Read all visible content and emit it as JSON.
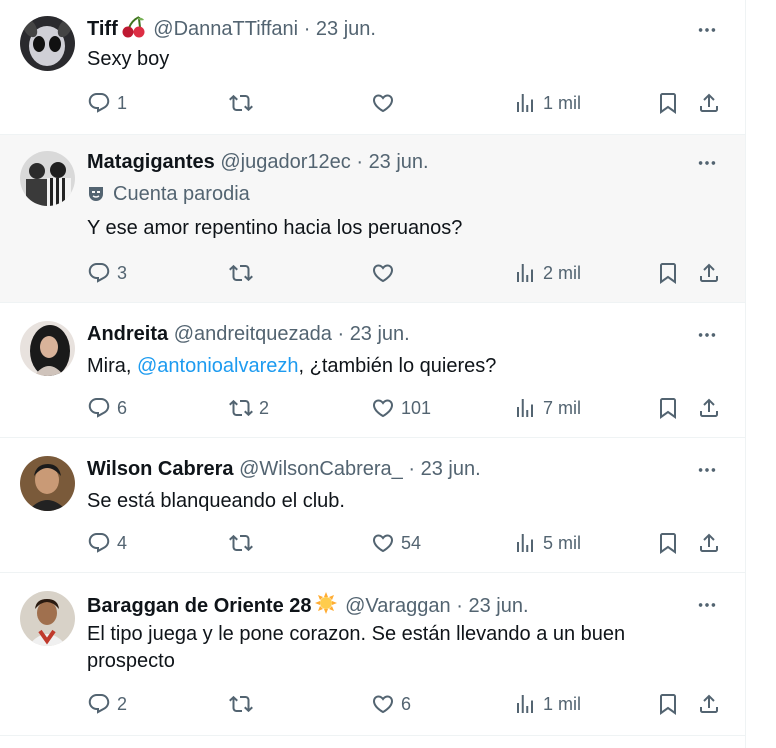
{
  "colors": {
    "text": "#0f1419",
    "secondary": "#536471",
    "link": "#1d9bf0",
    "highlight_bg": "#f7f7f7"
  },
  "icons": {
    "reply": "reply-icon",
    "retweet": "retweet-icon",
    "like": "heart-icon",
    "views": "views-icon",
    "bookmark": "bookmark-icon",
    "share": "share-icon",
    "more": "more-icon"
  },
  "tweets": [
    {
      "name": "Tiff",
      "name_emoji": "cherries-emoji",
      "handle": "@DannaTTiffani",
      "sep": "·",
      "date": "23 jun.",
      "text": "Sexy boy",
      "replies": "1",
      "retweets": "",
      "likes": "",
      "views": "1 mil"
    },
    {
      "name": "Matagigantes",
      "handle": "@jugador12ec",
      "sep": "·",
      "date": "23 jun.",
      "badge": "Cuenta parodia",
      "text": "Y ese amor repentino hacia los peruanos?",
      "replies": "3",
      "retweets": "",
      "likes": "",
      "views": "2 mil"
    },
    {
      "name": "Andreita",
      "handle": "@andreitquezada",
      "sep": "·",
      "date": "23 jun.",
      "text_before": "Mira, ",
      "mention": "@antonioalvarezh",
      "text_after": ", ¿también lo quieres?",
      "replies": "6",
      "retweets": "2",
      "likes": "101",
      "views": "7 mil"
    },
    {
      "name": "Wilson Cabrera",
      "handle": "@WilsonCabrera_",
      "sep": "·",
      "date": "23 jun.",
      "text": "Se está blanqueando el club.",
      "replies": "4",
      "retweets": "",
      "likes": "54",
      "views": "5 mil"
    },
    {
      "name": "Baraggan de Oriente 28",
      "name_emoji": "sun-emoji",
      "handle": "@Varaggan",
      "sep": "·",
      "date": "23 jun.",
      "text": "El tipo juega y le pone corazon. Se están llevando a un buen prospecto",
      "replies": "2",
      "retweets": "",
      "likes": "6",
      "views": "1 mil"
    }
  ]
}
